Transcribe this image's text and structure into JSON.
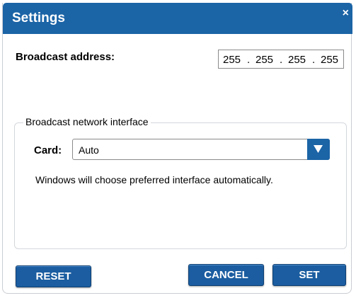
{
  "dialog": {
    "title": "Settings",
    "close_glyph": "×"
  },
  "broadcast": {
    "label": "Broadcast address:",
    "octets": [
      "255",
      "255",
      "255",
      "255"
    ],
    "separator": "."
  },
  "interface_group": {
    "legend": "Broadcast network interface",
    "card_label": "Card:",
    "card_value": "Auto",
    "hint": "Windows will choose preferred interface automatically."
  },
  "buttons": {
    "reset": "RESET",
    "cancel": "CANCEL",
    "set": "SET"
  },
  "colors": {
    "title_bar": "#1b64a6",
    "button": "#1b5da0"
  },
  "icons": {
    "close": "close-icon",
    "dropdown": "chevron-down-icon"
  }
}
